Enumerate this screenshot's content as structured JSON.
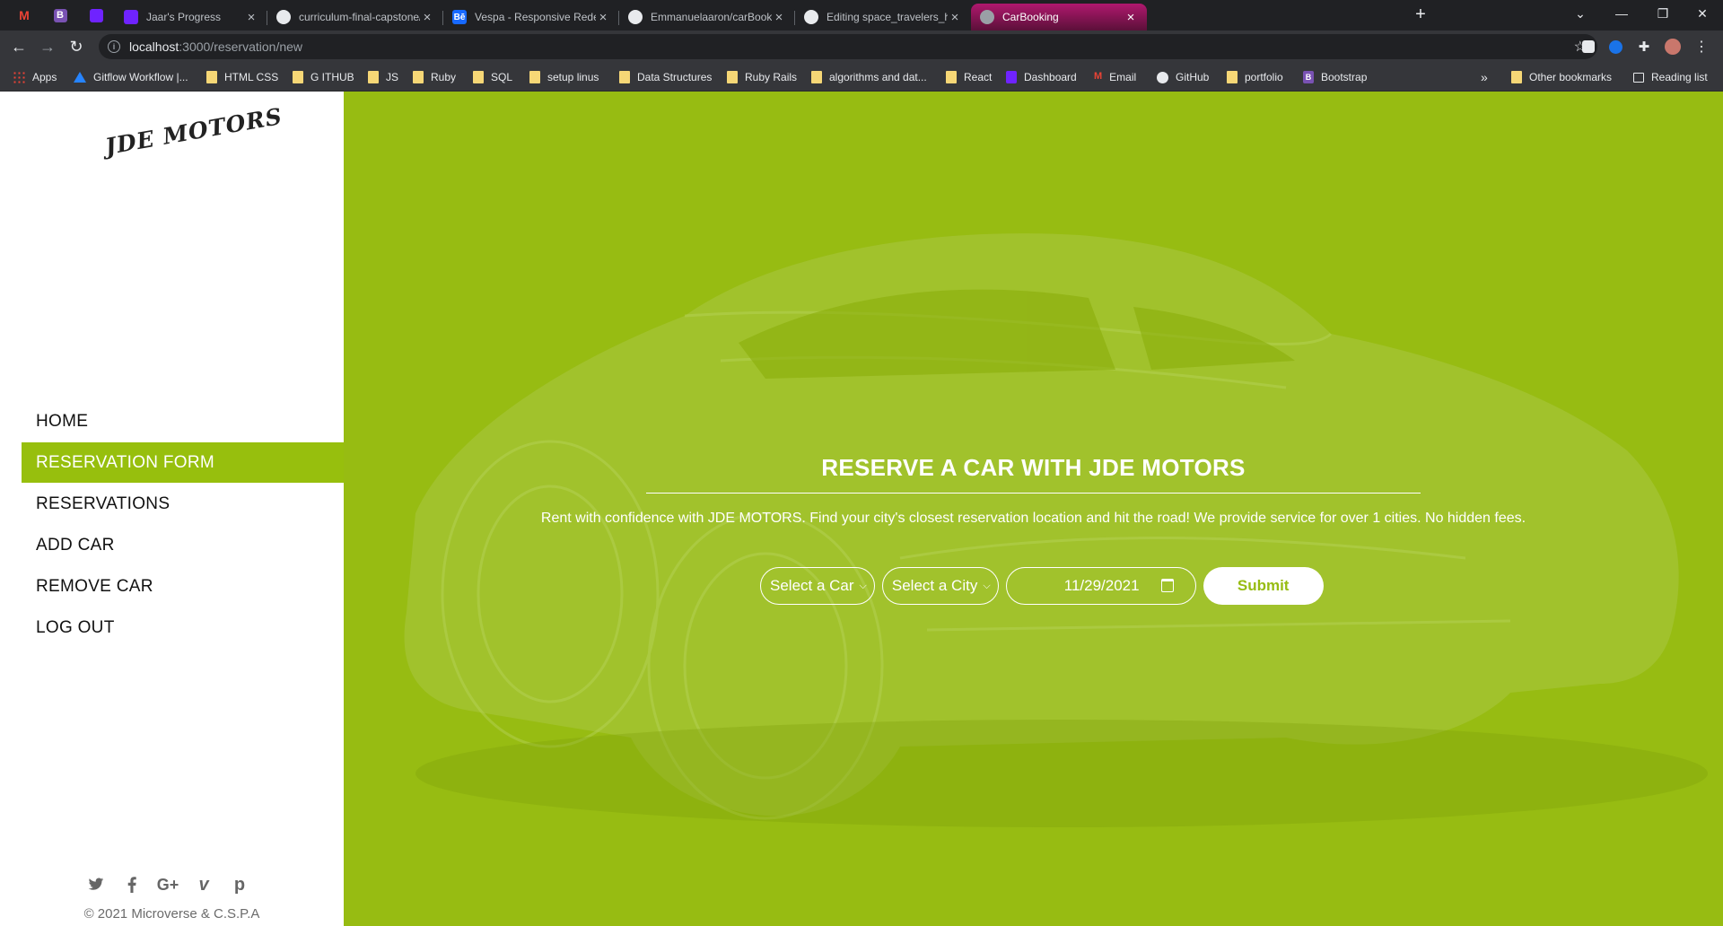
{
  "browser": {
    "tabs": [
      {
        "title": "Jaar's Progress",
        "icon": "microverse-icon"
      },
      {
        "title": "curriculum-final-capstone/busine",
        "icon": "github-icon"
      },
      {
        "title": "Vespa - Responsive Redesign on",
        "icon": "behance-icon",
        "favicon_text": "Bē"
      },
      {
        "title": "Emmanuelaaron/carBooking",
        "icon": "github-icon"
      },
      {
        "title": "Editing space_travelers_hub/REA",
        "icon": "github-icon"
      },
      {
        "title": "CarBooking",
        "icon": "globe-icon",
        "active": true
      }
    ],
    "pinned_tabs": [
      {
        "icon": "gmail-icon",
        "text": "M"
      },
      {
        "icon": "bootstrap-icon",
        "text": "B"
      },
      {
        "icon": "microverse-icon",
        "text": ""
      }
    ],
    "url": {
      "host": "localhost",
      "path": ":3000/reservation/new"
    },
    "bookmarks": [
      {
        "label": "Apps",
        "icon": "apps-grid-icon"
      },
      {
        "label": "Gitflow Workflow |...",
        "icon": "atlassian-icon"
      },
      {
        "label": "HTML CSS",
        "icon": "folder-icon"
      },
      {
        "label": "G ITHUB",
        "icon": "folder-icon"
      },
      {
        "label": "JS",
        "icon": "folder-icon"
      },
      {
        "label": "Ruby",
        "icon": "folder-icon"
      },
      {
        "label": "SQL",
        "icon": "folder-icon"
      },
      {
        "label": "setup linus",
        "icon": "folder-icon"
      },
      {
        "label": "Data Structures",
        "icon": "folder-icon"
      },
      {
        "label": "Ruby Rails",
        "icon": "folder-icon"
      },
      {
        "label": "algorithms and dat...",
        "icon": "folder-icon"
      },
      {
        "label": "React",
        "icon": "folder-icon"
      },
      {
        "label": "Dashboard",
        "icon": "microverse-icon"
      },
      {
        "label": "Email",
        "icon": "gmail-icon"
      },
      {
        "label": "GitHub",
        "icon": "github-icon"
      },
      {
        "label": "portfolio",
        "icon": "folder-icon"
      },
      {
        "label": "Bootstrap",
        "icon": "bootstrap-icon"
      }
    ],
    "bookmarks_overflow": "»",
    "other_bookmarks": "Other bookmarks",
    "reading_list": "Reading list"
  },
  "sidebar": {
    "logo": "JDE MOTORS",
    "nav": [
      {
        "label": "HOME"
      },
      {
        "label": "RESERVATION FORM",
        "active": true
      },
      {
        "label": "RESERVATIONS"
      },
      {
        "label": "ADD CAR"
      },
      {
        "label": "REMOVE CAR"
      },
      {
        "label": "LOG OUT"
      }
    ],
    "social_icons": [
      "twitter-icon",
      "facebook-icon",
      "google-plus-icon",
      "vimeo-icon",
      "pinterest-icon"
    ],
    "copyright": "© 2021 Microverse & C.S.P.A"
  },
  "main": {
    "title": "RESERVE A CAR WITH JDE MOTORS",
    "subtitle": "Rent with confidence with JDE MOTORS. Find your city's closest reservation location and hit the road! We provide service for over 1 cities. No hidden fees.",
    "form": {
      "car_select": "Select a Car",
      "city_select": "Select a City",
      "date_value": "11/29/2021",
      "submit_label": "Submit"
    },
    "accent_color": "#97bc12"
  }
}
